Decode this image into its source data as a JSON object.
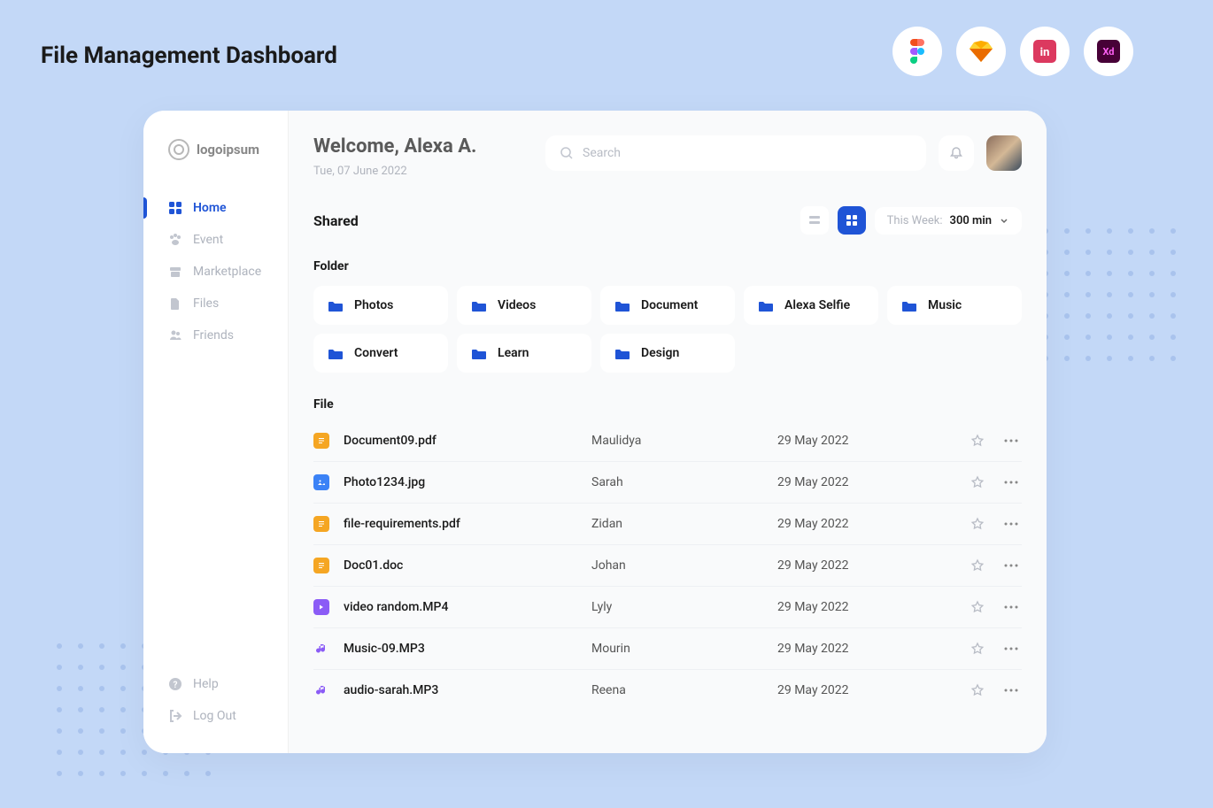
{
  "page_title": "File Management Dashboard",
  "logo_text": "logoipsum",
  "sidebar": {
    "items": [
      {
        "label": "Home",
        "active": true
      },
      {
        "label": "Event",
        "active": false
      },
      {
        "label": "Marketplace",
        "active": false
      },
      {
        "label": "Files",
        "active": false
      },
      {
        "label": "Friends",
        "active": false
      }
    ],
    "bottom": [
      {
        "label": "Help"
      },
      {
        "label": "Log Out"
      }
    ]
  },
  "header": {
    "welcome": "Welcome, Alexa A.",
    "date": "Tue, 07 June 2022",
    "search_placeholder": "Search"
  },
  "shared_section_title": "Shared",
  "dropdown": {
    "label": "This Week:",
    "value": "300 min"
  },
  "folder_title": "Folder",
  "folders": [
    {
      "name": "Photos"
    },
    {
      "name": "Videos"
    },
    {
      "name": "Document"
    },
    {
      "name": "Alexa Selfie"
    },
    {
      "name": "Music"
    },
    {
      "name": "Convert"
    },
    {
      "name": "Learn"
    },
    {
      "name": "Design"
    }
  ],
  "file_title": "File",
  "files": [
    {
      "name": "Document09.pdf",
      "owner": "Maulidya",
      "date": "29 May 2022",
      "type": "doc"
    },
    {
      "name": "Photo1234.jpg",
      "owner": "Sarah",
      "date": "29 May 2022",
      "type": "img"
    },
    {
      "name": "file-requirements.pdf",
      "owner": "Zidan",
      "date": "29 May 2022",
      "type": "doc"
    },
    {
      "name": "Doc01.doc",
      "owner": "Johan",
      "date": "29 May 2022",
      "type": "doc"
    },
    {
      "name": "video random.MP4",
      "owner": "Lyly",
      "date": "29 May 2022",
      "type": "vid"
    },
    {
      "name": "Music-09.MP3",
      "owner": "Mourin",
      "date": "29 May 2022",
      "type": "aud"
    },
    {
      "name": "audio-sarah.MP3",
      "owner": "Reena",
      "date": "29 May 2022",
      "type": "aud"
    }
  ],
  "tool_badges": [
    "figma",
    "sketch",
    "invision",
    "xd"
  ]
}
